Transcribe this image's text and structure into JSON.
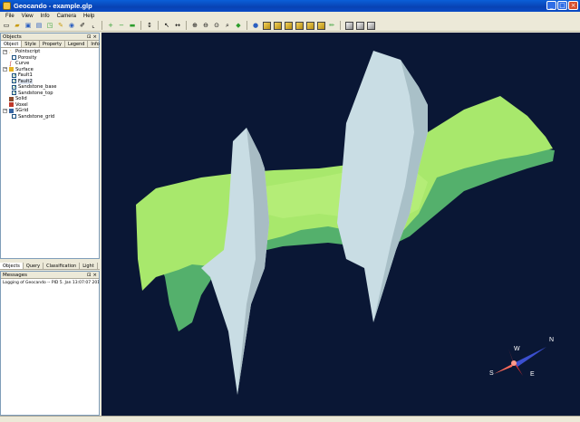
{
  "window": {
    "title": "Geocando - example.glp"
  },
  "menu": [
    "File",
    "View",
    "Info",
    "Camera",
    "Help"
  ],
  "objects_panel": {
    "title": "Objects",
    "tabs": [
      "Object",
      "Style",
      "Property",
      "Legend",
      "Info"
    ],
    "tree": [
      {
        "label": "Pointscript"
      },
      {
        "label": "Porosity"
      },
      {
        "label": "Curve"
      },
      {
        "label": "Surface"
      },
      {
        "label": "Fault1"
      },
      {
        "label": "Fault2"
      },
      {
        "label": "Sandstone_base"
      },
      {
        "label": "Sandstone_top"
      },
      {
        "label": "Solid"
      },
      {
        "label": "Voxel"
      },
      {
        "label": "SGrid"
      },
      {
        "label": "Sandstone_grid"
      }
    ]
  },
  "bottom_tabs": [
    "Objects",
    "Query",
    "Classification",
    "Light"
  ],
  "messages_panel": {
    "title": "Messages",
    "text": "Logging of Geocando -- PID 5. Jan 13:07:07 2011"
  },
  "compass": {
    "n": "N",
    "s": "S",
    "e": "E",
    "w": "W"
  },
  "colors": {
    "viewport_bg": "#0a1735",
    "surface_top": "#a6e86a",
    "surface_base": "#55b26c",
    "fault": "#c9dde4"
  }
}
